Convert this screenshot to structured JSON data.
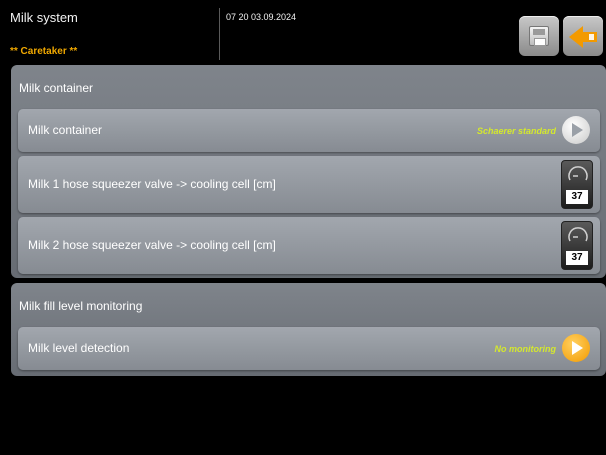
{
  "header": {
    "title": "Milk system",
    "role": "** Caretaker **",
    "datetime": "07 20 03.09.2024",
    "save_icon": "save-icon",
    "back_icon": "back-arrow-icon",
    "back_color": "#f39a00"
  },
  "sections": [
    {
      "title": "Milk container",
      "rows": [
        {
          "label": "Milk container",
          "value": "Schaerer standard",
          "control": "play-icon"
        },
        {
          "label": "Milk 1 hose squeezer valve -> cooling cell [cm]",
          "value": "37",
          "control": "gauge-icon"
        },
        {
          "label": "Milk 2 hose squeezer valve -> cooling cell [cm]",
          "value": "37",
          "control": "gauge-icon"
        }
      ]
    },
    {
      "title": "Milk fill level monitoring",
      "rows": [
        {
          "label": "Milk level detection",
          "value": "No monitoring",
          "control": "play-icon"
        }
      ]
    }
  ],
  "colors": {
    "value_text": "#d4e82e",
    "role_text": "#f0a800",
    "accent_orange": "#f39a00"
  }
}
